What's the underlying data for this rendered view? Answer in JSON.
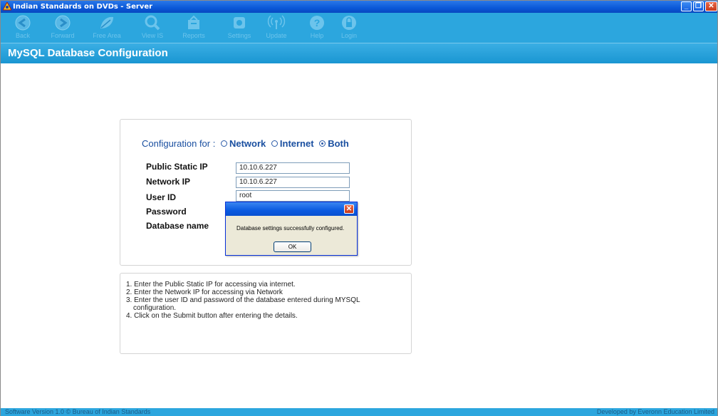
{
  "window": {
    "title": "Indian Standards on DVDs - Server",
    "controls": {
      "minimize": "_",
      "maximize": "❐",
      "close": "✕"
    }
  },
  "toolbar": {
    "items": [
      {
        "label": "Back",
        "icon": "back-arrow-icon"
      },
      {
        "label": "Forward",
        "icon": "forward-arrow-icon"
      },
      {
        "label": "Free Area",
        "icon": "leaf-icon"
      },
      {
        "label": "View IS",
        "icon": "magnifier-icon"
      },
      {
        "label": "Reports",
        "icon": "reports-icon"
      },
      {
        "label": "Settings",
        "icon": "settings-icon"
      },
      {
        "label": "Update",
        "icon": "wireless-update-icon"
      },
      {
        "label": "Help",
        "icon": "help-icon"
      },
      {
        "label": "Login",
        "icon": "lock-icon"
      }
    ]
  },
  "page": {
    "title": "MySQL Database Configuration"
  },
  "config": {
    "prefix": "Configuration for :",
    "options": [
      {
        "label": "Network",
        "selected": false
      },
      {
        "label": "Internet",
        "selected": false
      },
      {
        "label": "Both",
        "selected": true
      }
    ],
    "fields": {
      "public_ip": {
        "label": "Public Static IP",
        "value": "10.10.6.227"
      },
      "network_ip": {
        "label": "Network IP",
        "value": "10.10.6.227"
      },
      "user_id": {
        "label": "User ID",
        "value": "root"
      },
      "password": {
        "label": "Password",
        "value": ""
      },
      "database": {
        "label": "Database name",
        "value": ""
      }
    }
  },
  "instructions": [
    "1. Enter the Public Static IP for accessing via internet.",
    "2. Enter the Network IP for accessing via Network",
    "3. Enter the user ID and password of the database entered during MYSQL configuration.",
    "4. Click on the Submit button after entering the details."
  ],
  "dialog": {
    "message": "Database settings successfully configured.",
    "ok_label": "OK",
    "close_glyph": "✕"
  },
  "status": {
    "left": "Software Version 1.0   © Bureau of Indian Standards",
    "right": "Developed by Everonn Education Limited"
  },
  "colors": {
    "accent": "#2ca6de",
    "title_bar": "#0a58d8",
    "link_blue": "#1a4fa0"
  }
}
